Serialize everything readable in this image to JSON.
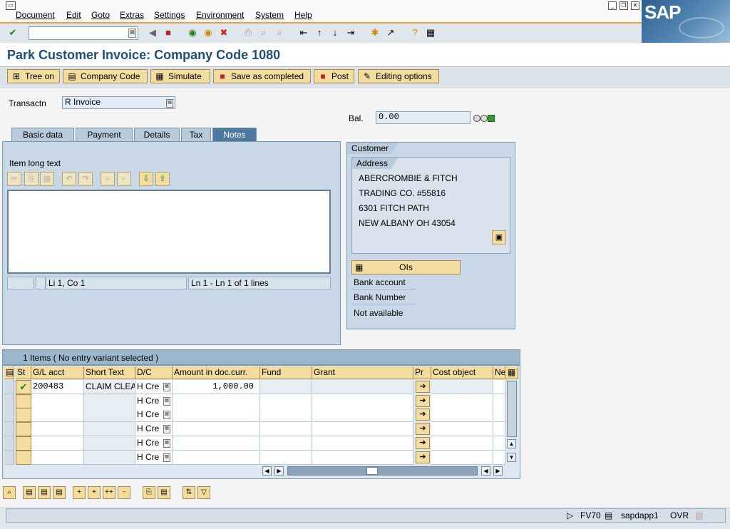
{
  "menu": {
    "items": [
      "Document",
      "Edit",
      "Goto",
      "Extras",
      "Settings",
      "Environment",
      "System",
      "Help"
    ],
    "brand": "SAP"
  },
  "toolbar": {
    "command_field_value": "",
    "icons": [
      "enter-icon",
      "back-icon",
      "save-icon",
      "green-back-icon",
      "exit-icon",
      "cancel-icon",
      "print-icon",
      "find-icon",
      "find-next-icon",
      "first-page-icon",
      "previous-page-icon",
      "next-page-icon",
      "last-page-icon",
      "new-session-icon",
      "shortcut-icon",
      "help-icon",
      "layout-icon"
    ]
  },
  "page": {
    "title": "Park Customer Invoice: Company Code 1080"
  },
  "app_toolbar": {
    "tree_on": "Tree on",
    "company_code": "Company Code",
    "simulate": "Simulate",
    "save_as_completed": "Save as completed",
    "post": "Post",
    "editing_options": "Editing options"
  },
  "form": {
    "transaction_label": "Transactn",
    "transaction_value": "R Invoice",
    "balance_label": "Bal.",
    "balance_value": "0.00",
    "status_light_color": "#22aa22"
  },
  "tabs": [
    "Basic data",
    "Payment",
    "Details",
    "Tax",
    "Notes"
  ],
  "active_tab": "Notes",
  "notes": {
    "item_long_text_label": "Item long text",
    "text": "",
    "cursor_position": "Li 1, Co 1",
    "line_info": "Ln 1 - Ln 1 of 1 lines"
  },
  "customer": {
    "group_title": "Customer",
    "address_title": "Address",
    "address_lines": [
      "ABERCROMBIE & FITCH",
      "TRADING CO.  #55816",
      "6301 FITCH PATH",
      "NEW ALBANY OH  43054"
    ],
    "ois_button": "OIs",
    "bank_account_label": "Bank account",
    "bank_number_label": "Bank Number",
    "not_available": "Not available"
  },
  "items_table": {
    "header_text": "1 Items ( No entry variant selected )",
    "columns": [
      "St",
      "G/L acct",
      "Short Text",
      "D/C",
      "Amount in doc.curr.",
      "Fund",
      "Grant",
      "Pr",
      "Cost object",
      "Ne"
    ],
    "rows": [
      {
        "status": "✔",
        "gl_acct": "200483",
        "short_text": "CLAIM CLEAR",
        "dc": "H Cre",
        "amount": "1,000.00",
        "fund": "",
        "grant": "",
        "cost_object": ""
      },
      {
        "status": "",
        "gl_acct": "",
        "short_text": "",
        "dc": "H Cre",
        "amount": "",
        "fund": "",
        "grant": "",
        "cost_object": ""
      },
      {
        "status": "",
        "gl_acct": "",
        "short_text": "",
        "dc": "H Cre",
        "amount": "",
        "fund": "",
        "grant": "",
        "cost_object": ""
      },
      {
        "status": "",
        "gl_acct": "",
        "short_text": "",
        "dc": "H Cre",
        "amount": "",
        "fund": "",
        "grant": "",
        "cost_object": ""
      },
      {
        "status": "",
        "gl_acct": "",
        "short_text": "",
        "dc": "H Cre",
        "amount": "",
        "fund": "",
        "grant": "",
        "cost_object": ""
      },
      {
        "status": "",
        "gl_acct": "",
        "short_text": "",
        "dc": "H Cre",
        "amount": "",
        "fund": "",
        "grant": "",
        "cost_object": ""
      }
    ]
  },
  "statusbar": {
    "transaction_code": "FV70",
    "server": "sapdapp1",
    "mode": "OVR"
  }
}
